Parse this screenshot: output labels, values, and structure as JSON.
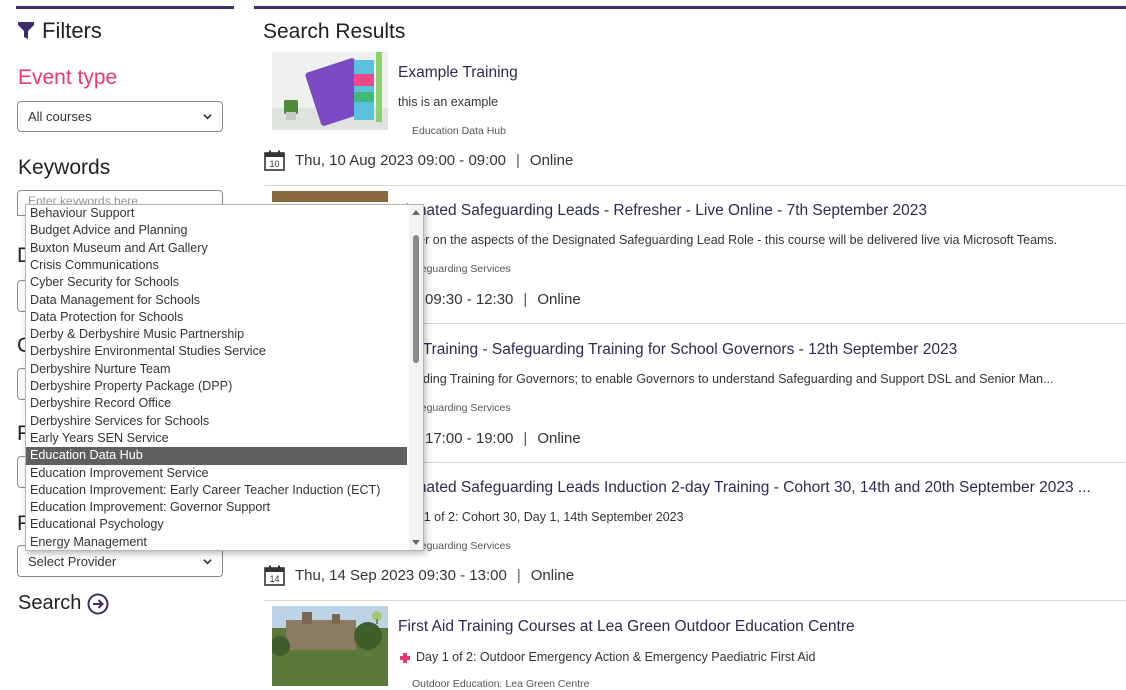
{
  "sidebar": {
    "filters_title": "Filters",
    "event_type_heading": "Event type",
    "event_type_value": "All courses",
    "keywords_heading": "Keywords",
    "keywords_placeholder": "Enter keywords here",
    "ghost_letters": [
      "D",
      "C",
      "F",
      "F"
    ],
    "provider_value": "Select Provider",
    "search_label": "Search"
  },
  "dropdown": {
    "selected_index": 14,
    "options": [
      "Behaviour Support",
      "Budget Advice and Planning",
      "Buxton Museum and Art Gallery",
      "Crisis Communications",
      "Cyber Security for Schools",
      "Data Management for Schools",
      "Data Protection for Schools",
      "Derby & Derbyshire Music Partnership",
      "Derbyshire Environmental Studies Service",
      "Derbyshire Nurture Team",
      "Derbyshire Property Package (DPP)",
      "Derbyshire Record Office",
      "Derbyshire Services for Schools",
      "Early Years SEN Service",
      "Education Data Hub",
      "Education Improvement Service",
      "Education Improvement: Early Career Teacher Induction (ECT)",
      "Education Improvement: Governor Support",
      "Educational Psychology",
      "Energy Management"
    ]
  },
  "results": {
    "heading": "Search Results",
    "items": [
      {
        "title": "Example Training",
        "desc": "this is an example",
        "provider": "Education Data Hub",
        "cal_day": "10",
        "date": "Thu, 10 Aug 2023 09:00 - 09:00",
        "sep": "|",
        "mode": "Online"
      },
      {
        "title": "signated Safeguarding Leads - Refresher - Live Online - 7th September 2023",
        "desc": "esher on the aspects of the Designated Safeguarding Lead Role - this course will be delivered live via Microsoft Teams.",
        "provider": "afeguarding Services",
        "date": "09:30 - 12:30",
        "sep": "|",
        "mode": "Online"
      },
      {
        "title": "ual Training - Safeguarding Training for School Governors - 12th September 2023",
        "desc": "guarding Training for Governors; to enable Governors to understand Safeguarding and Support DSL and Senior Man...",
        "provider": "afeguarding Services",
        "date": "17:00 - 19:00",
        "sep": "|",
        "mode": "Online"
      },
      {
        "title": "signated Safeguarding Leads Induction 2-day Training - Cohort 30, 14th and 20th September 2023 ...",
        "desc": "Day 1 of 2: Cohort 30, Day 1, 14th September 2023",
        "provider": "afeguarding Services",
        "cal_day": "14",
        "date": "Thu, 14 Sep 2023 09:30 - 13:00",
        "sep": "|",
        "mode": "Online"
      },
      {
        "title": "First Aid Training Courses at Lea Green Outdoor Education Centre",
        "desc": "Day 1 of 2: Outdoor Emergency Action & Emergency Paediatric First Aid",
        "provider": "Outdoor Education: Lea Green Centre"
      }
    ]
  },
  "colors": {
    "accent_bar": "#3f2a6b",
    "event_type_heading": "#e8386d",
    "selected_option_bg": "#5f5f5f"
  },
  "icons": [
    "funnel-icon",
    "chevron-down-icon",
    "arrow-circle-right-icon",
    "calendar-icon",
    "scroll-up-icon",
    "scroll-down-icon"
  ]
}
